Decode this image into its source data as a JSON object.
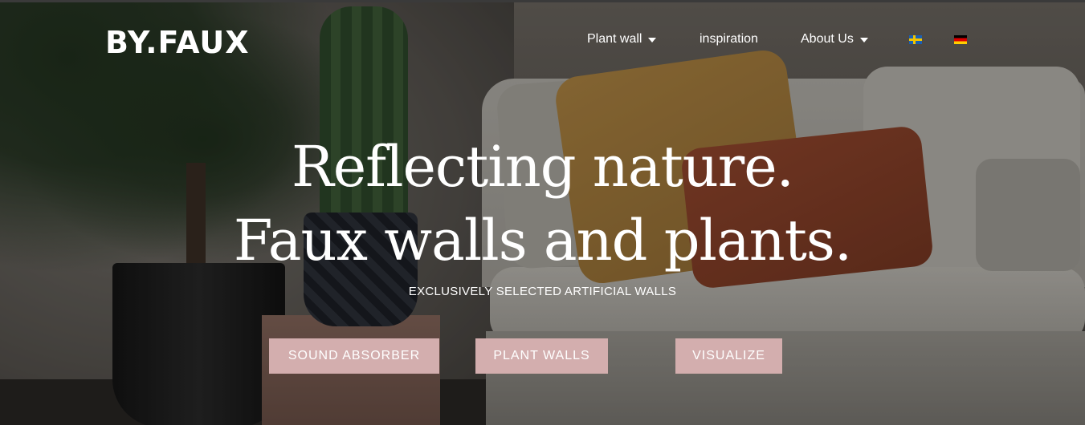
{
  "brand": {
    "logo_text": "BY.FAUX"
  },
  "nav": {
    "items": [
      {
        "label": "Plant wall",
        "has_dropdown": true
      },
      {
        "label": "inspiration",
        "has_dropdown": false
      },
      {
        "label": "About Us",
        "has_dropdown": true
      }
    ],
    "languages": [
      {
        "code": "sv",
        "icon": "sweden-flag-icon"
      },
      {
        "code": "de",
        "icon": "germany-flag-icon"
      }
    ]
  },
  "hero": {
    "headline_line1": "Reflecting nature.",
    "headline_line2": "Faux walls and plants.",
    "subheading": "EXCLUSIVELY SELECTED ARTIFICIAL WALLS",
    "buttons": [
      {
        "label": "SOUND ABSORBER"
      },
      {
        "label": "PLANT WALLS"
      },
      {
        "label": "VISUALIZE"
      }
    ]
  },
  "colors": {
    "button_bg": "#d3aeae",
    "text": "#ffffff"
  }
}
